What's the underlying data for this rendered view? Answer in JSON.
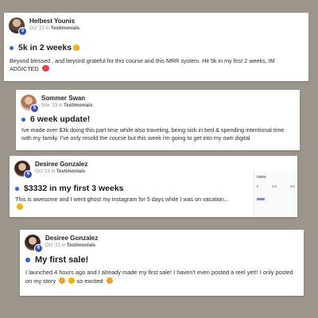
{
  "posts": [
    {
      "author": "Helbest Younis",
      "level": "5",
      "date": "Oct '23",
      "in_text": "in",
      "category": "Testimonials",
      "title": "5k in 2 weeks",
      "title_emoji": "crying-face-emoji",
      "body": "Beyond blessed , and beyond grateful for this course and this MRR system. Hit 5k in my first 2 weeks, IM ADDICTED",
      "body_emoji": "heart-eyes-emoji"
    },
    {
      "author": "Sommer Swan",
      "level": "5",
      "date": "Nov '23",
      "in_text": "in",
      "category": "Testimonials",
      "title": "6 week update!",
      "body": "Ive made over $3k doing this part time while also traveling, being sick in bed & spending intentional time with my family. I've only resold the course but this week i'm going to get into my own digital"
    },
    {
      "author": "Desiree Gonzalez",
      "level": "6",
      "date": "Oct '23",
      "in_text": "in",
      "category": "Testimonials",
      "title": "$3332 in my first 3 weeks",
      "body": "This is awesome and I went ghost my instagram for 5 days while I was on vacation...",
      "body_emoji": "grin-emoji",
      "overlay": {
        "title": "rview",
        "cols": [
          "k",
          "6/5",
          "6/5"
        ]
      }
    },
    {
      "author": "Desiree Gonzalez",
      "level": "6",
      "date": "Oct '23",
      "in_text": "in",
      "category": "Testimonials",
      "title": "My first sale!",
      "body": "I launched 4 hours ago and I already made my first sale! I haven't even posted a reel yet!! I only posted on my story",
      "body_tail": "so excited"
    }
  ],
  "colors": {
    "accent_dot": "#2d62e0",
    "level_badge": "#3b53b8",
    "background": "#9c958c"
  }
}
